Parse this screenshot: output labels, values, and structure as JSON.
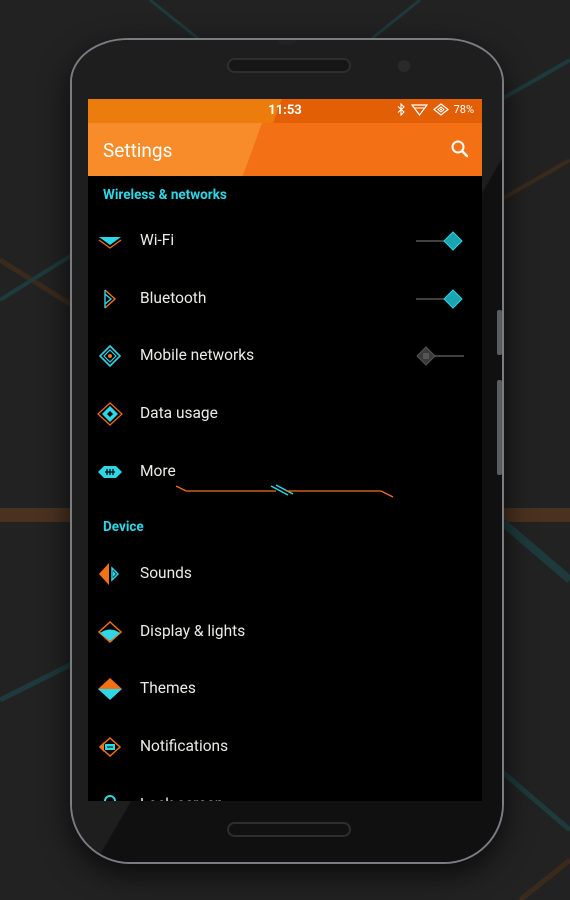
{
  "status_bar": {
    "time": "11:53",
    "battery": "78%",
    "icons": [
      "bluetooth-icon",
      "wifi-icon",
      "signal-icon"
    ]
  },
  "app_bar": {
    "title": "Settings",
    "search_icon": "search-icon"
  },
  "sections": [
    {
      "header": "Wireless & networks",
      "items": [
        {
          "label": "Wi-Fi",
          "icon": "wifi-icon",
          "toggle": true,
          "toggle_on": true
        },
        {
          "label": "Bluetooth",
          "icon": "bluetooth-icon",
          "toggle": true,
          "toggle_on": true
        },
        {
          "label": "Mobile networks",
          "icon": "mobile-networks-icon",
          "toggle": true,
          "toggle_on": false
        },
        {
          "label": "Data usage",
          "icon": "data-usage-icon",
          "toggle": false
        },
        {
          "label": "More",
          "icon": "more-icon",
          "toggle": false
        }
      ]
    },
    {
      "header": "Device",
      "items": [
        {
          "label": "Sounds",
          "icon": "sounds-icon"
        },
        {
          "label": "Display & lights",
          "icon": "display-icon"
        },
        {
          "label": "Themes",
          "icon": "themes-icon"
        },
        {
          "label": "Notifications",
          "icon": "notifications-icon"
        },
        {
          "label": "Lock screen",
          "icon": "lock-icon"
        }
      ]
    }
  ],
  "colors": {
    "accent_orange": "#f47015",
    "accent_cyan": "#2ed6e6",
    "toggle_on": "#1aa3b0",
    "toggle_off": "#4a4a4a"
  }
}
